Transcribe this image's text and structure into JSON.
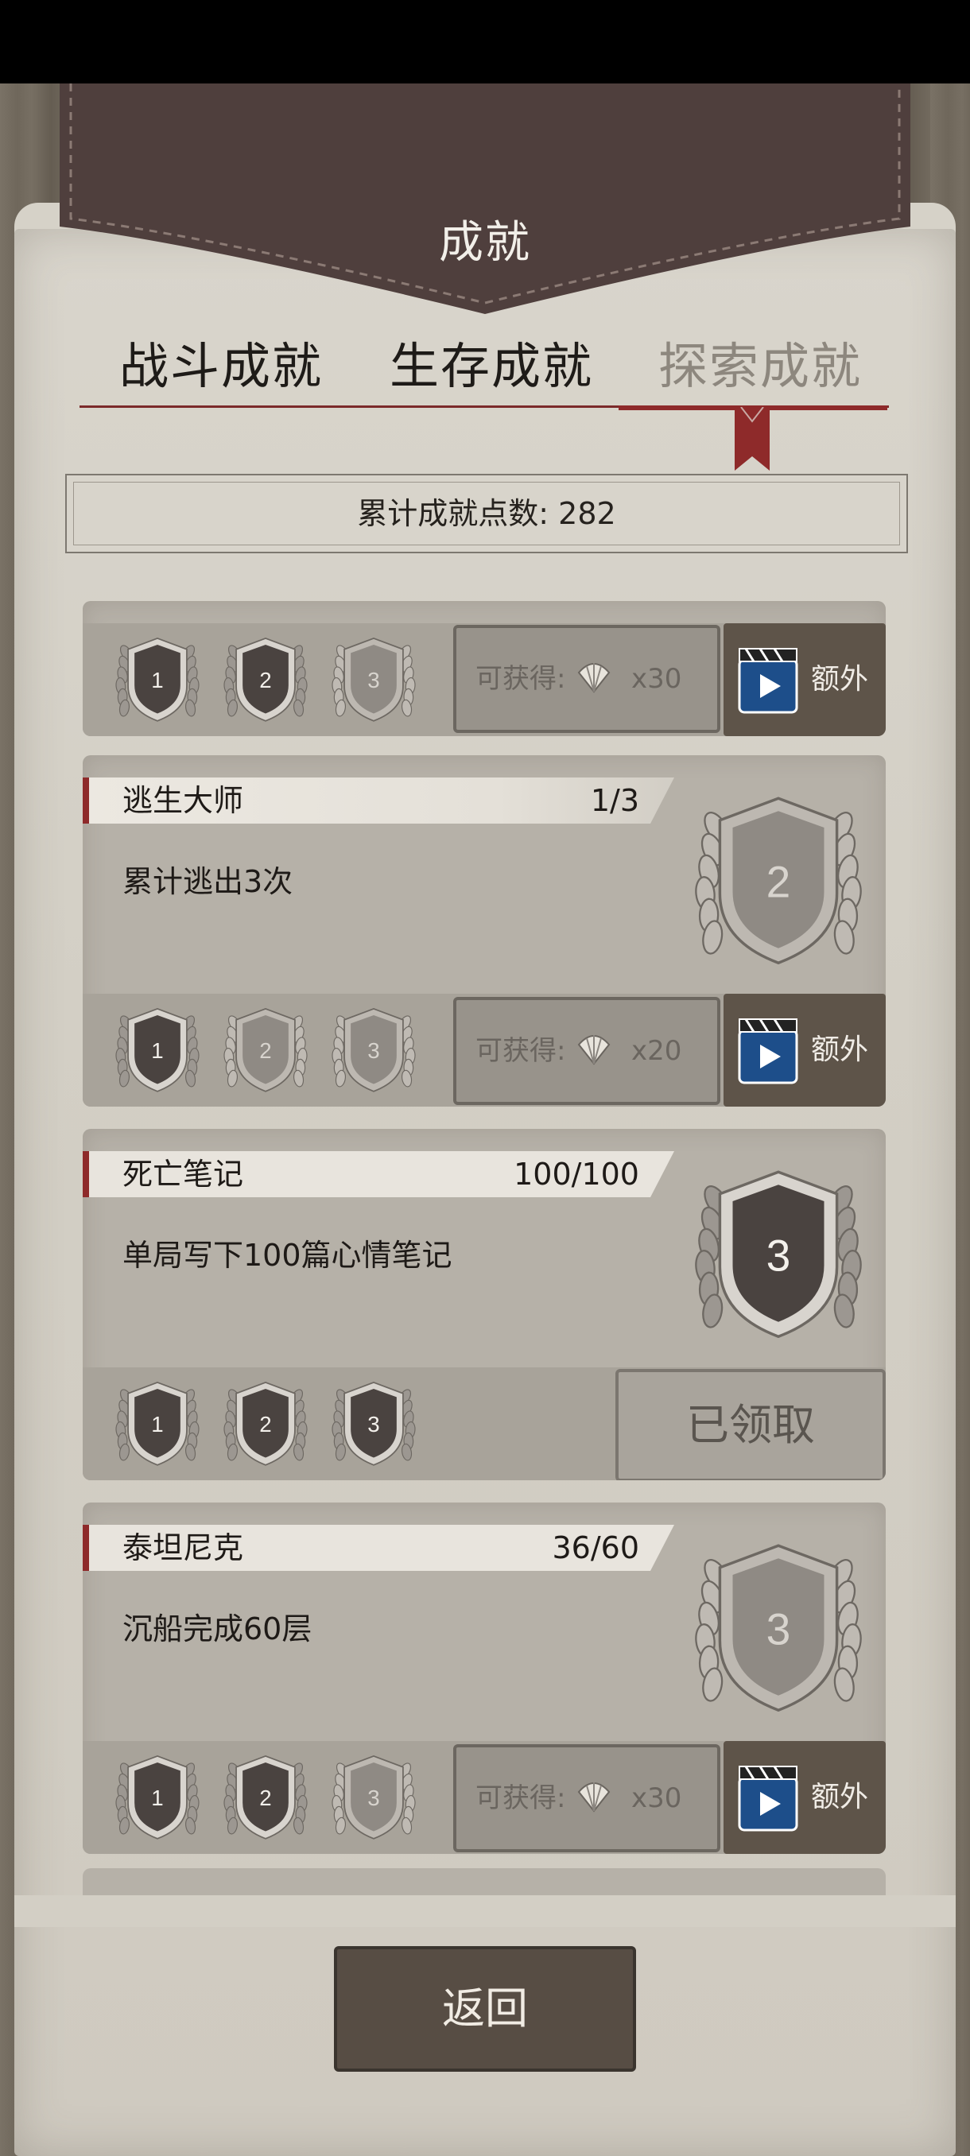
{
  "title": "成就",
  "tabs": [
    {
      "label": "战斗成就",
      "active": false
    },
    {
      "label": "生存成就",
      "active": false
    },
    {
      "label": "探索成就",
      "active": true
    }
  ],
  "points_label": "累计成就点数: 282",
  "reward_label": "可获得:",
  "extra_label": "额外",
  "claimed_label": "已领取",
  "return_label": "返回",
  "partial_card": {
    "tiers": [
      "1",
      "2",
      "3"
    ],
    "tier_state": [
      "earned",
      "earned",
      "locked"
    ],
    "reward_qty": "x30"
  },
  "cards": [
    {
      "name": "逃生大师",
      "progress": "1/3",
      "desc": "累计逃出3次",
      "big_tier": "2",
      "big_state": "locked",
      "tiers": [
        "1",
        "2",
        "3"
      ],
      "tier_state": [
        "earned",
        "locked",
        "locked"
      ],
      "reward_qty": "x20",
      "claimed": false
    },
    {
      "name": "死亡笔记",
      "progress": "100/100",
      "desc": "单局写下100篇心情笔记",
      "big_tier": "3",
      "big_state": "earned",
      "tiers": [
        "1",
        "2",
        "3"
      ],
      "tier_state": [
        "earned",
        "earned",
        "earned"
      ],
      "reward_qty": "",
      "claimed": true
    },
    {
      "name": "泰坦尼克",
      "progress": "36/60",
      "desc": "沉船完成60层",
      "big_tier": "3",
      "big_state": "locked",
      "tiers": [
        "1",
        "2",
        "3"
      ],
      "tier_state": [
        "earned",
        "earned",
        "locked"
      ],
      "reward_qty": "x30",
      "claimed": false
    }
  ],
  "colors": {
    "earned_badge": "#4a4340",
    "locked_badge": "#8f8a84",
    "accent": "#8e2a2a"
  },
  "icons": {
    "reward": "shell-icon",
    "extra": "video-clapper-icon"
  }
}
